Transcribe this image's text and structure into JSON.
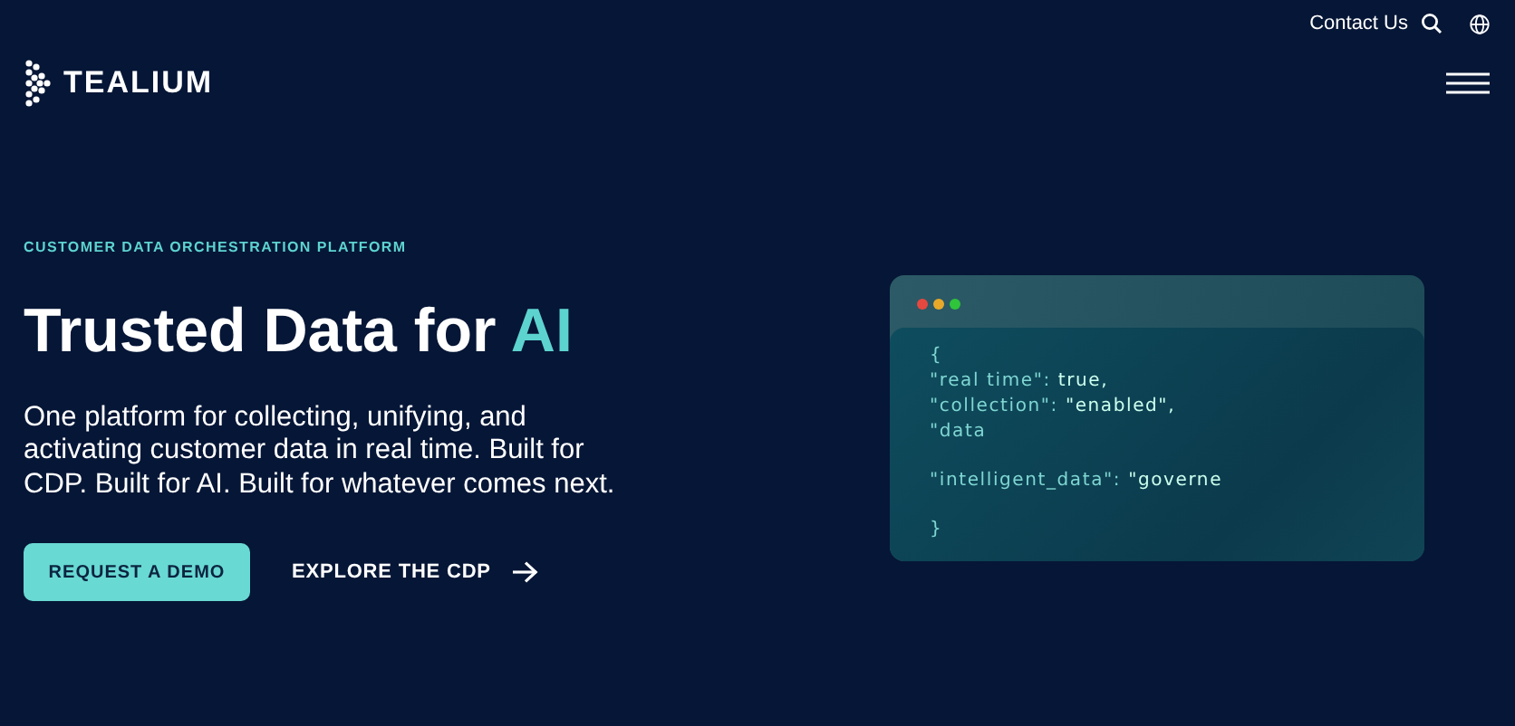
{
  "top_bar": {
    "contact": "Contact Us"
  },
  "logo": {
    "text": "TEALIUM"
  },
  "hero": {
    "eyebrow": "CUSTOMER DATA ORCHESTRATION PLATFORM",
    "headline": "Trusted Data for",
    "headline_accent": "AI",
    "body": "One platform for collecting, unifying, and activating customer data in real time. Built for CDP. Built for AI. Built for whatever comes next.",
    "buttons": [
      {
        "label": "REQUEST A DEMO",
        "kind": "primary"
      },
      {
        "label": "EXPLORE THE CDP",
        "kind": "arrow"
      }
    ]
  },
  "code_card": {
    "blocks": [
      [
        {
          "key": "{"
        },
        {
          "key": "\"real time\":",
          "value": "true,"
        },
        {
          "key": "\"collection\":",
          "value": "\"enabled\","
        },
        {
          "key": "\"data"
        }
      ],
      [
        {
          "key": "\"intelligent_data\":",
          "value": "\"governe"
        }
      ],
      [
        {
          "key": "}"
        }
      ]
    ]
  }
}
